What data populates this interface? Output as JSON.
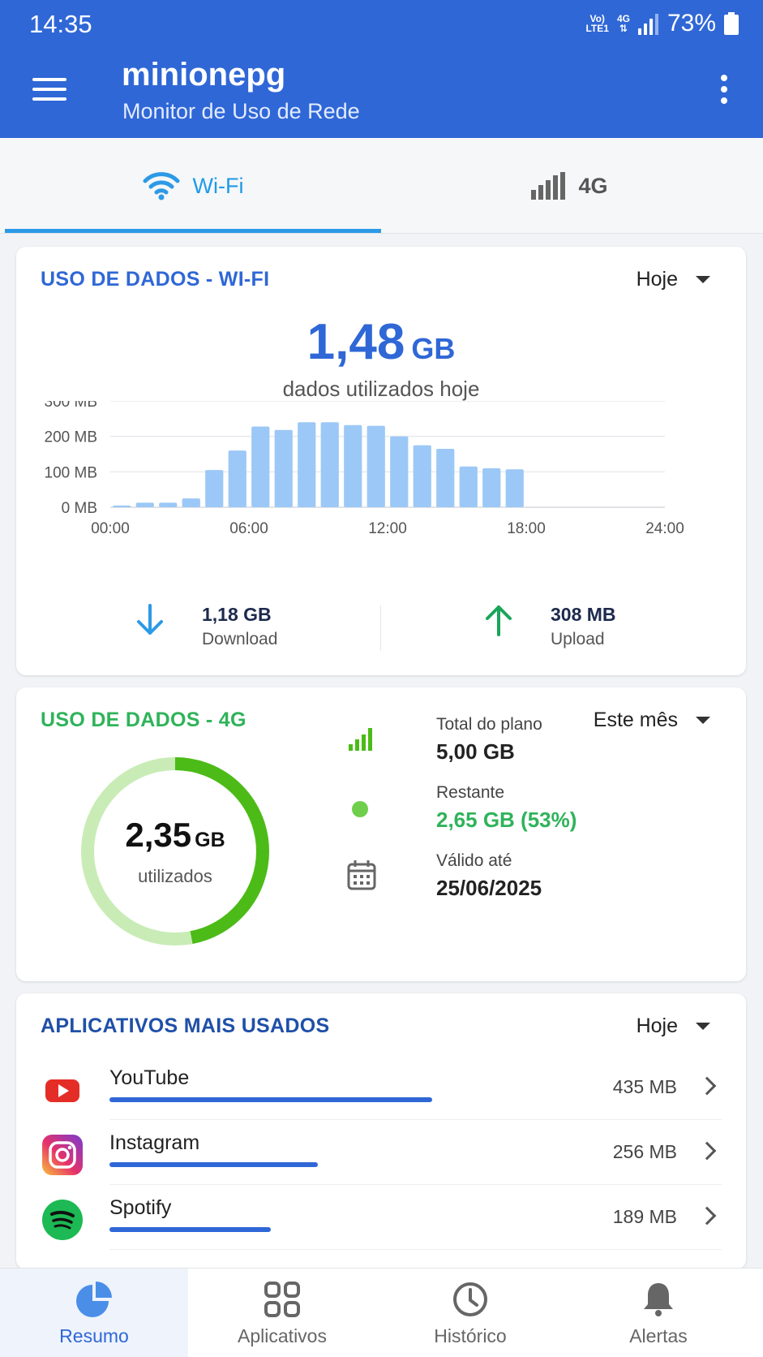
{
  "status_bar": {
    "time": "14:35",
    "volte": "Vo)",
    "lte": "LTE1",
    "network": "4G",
    "battery": "73%"
  },
  "header": {
    "title": "minionepg",
    "subtitle": "Monitor de Uso de Rede"
  },
  "tabs": [
    {
      "label": "Wi-Fi",
      "icon": "wifi-icon",
      "active": true
    },
    {
      "label": "4G",
      "icon": "signal-bars-icon",
      "active": false
    }
  ],
  "wifi_card": {
    "title": "USO DE DADOS - WI-FI",
    "period": "Hoje",
    "total_value": "1,48",
    "total_unit": "GB",
    "caption": "dados utilizados hoje",
    "download_value": "1,18 GB",
    "download_label": "Download",
    "upload_value": "308 MB",
    "upload_label": "Upload"
  },
  "chart_data": {
    "type": "bar",
    "title": "",
    "xlabel": "",
    "ylabel": "",
    "y_ticks": [
      "0 MB",
      "100 MB",
      "200 MB",
      "300 MB"
    ],
    "x_ticks": [
      "00:00",
      "06:00",
      "12:00",
      "18:00",
      "24:00"
    ],
    "ylim": [
      0,
      300
    ],
    "xlim": [
      0,
      24
    ],
    "categories": [
      "00:00",
      "01:00",
      "02:00",
      "03:00",
      "04:00",
      "05:00",
      "06:00",
      "07:00",
      "08:00",
      "09:00",
      "10:00",
      "11:00",
      "12:00",
      "13:00",
      "14:00",
      "15:00",
      "16:00",
      "17:00"
    ],
    "values": [
      5,
      13,
      13,
      25,
      105,
      160,
      228,
      218,
      240,
      240,
      232,
      230,
      200,
      175,
      165,
      115,
      110,
      107
    ],
    "color": "#9cc8f7",
    "grid": true
  },
  "g4_card": {
    "title": "USO DE DADOS - 4G",
    "period": "Este mês",
    "used_value": "2,35",
    "used_unit": "GB",
    "used_caption": "utilizados",
    "used_fraction": 0.47,
    "plan_label": "Total do plano",
    "plan_value": "5,00 GB",
    "remaining_label": "Restante",
    "remaining_value": "2,65 GB (53%)",
    "valid_label": "Válido até",
    "valid_value": "25/06/2025",
    "colors": {
      "used": "#4cbb17",
      "remaining": "#c9ecb6",
      "accent": "#2fb35a"
    }
  },
  "apps_card": {
    "title": "APLICATIVOS MAIS USADOS",
    "period": "Hoje",
    "apps": [
      {
        "name": "YouTube",
        "size": "435 MB",
        "usage_fraction": 0.58
      },
      {
        "name": "Instagram",
        "size": "256 MB",
        "usage_fraction": 0.375
      },
      {
        "name": "Spotify",
        "size": "189 MB",
        "usage_fraction": 0.29
      }
    ]
  },
  "bottom_nav": [
    {
      "label": "Resumo",
      "icon": "pie-chart-icon",
      "active": true
    },
    {
      "label": "Aplicativos",
      "icon": "apps-grid-icon",
      "active": false
    },
    {
      "label": "Histórico",
      "icon": "clock-icon",
      "active": false
    },
    {
      "label": "Alertas",
      "icon": "bell-icon",
      "active": false
    }
  ],
  "colors": {
    "primary": "#2f67d6",
    "wifi_accent": "#2c9ae6",
    "download": "#2c9ae6",
    "upload": "#1aa55a"
  }
}
